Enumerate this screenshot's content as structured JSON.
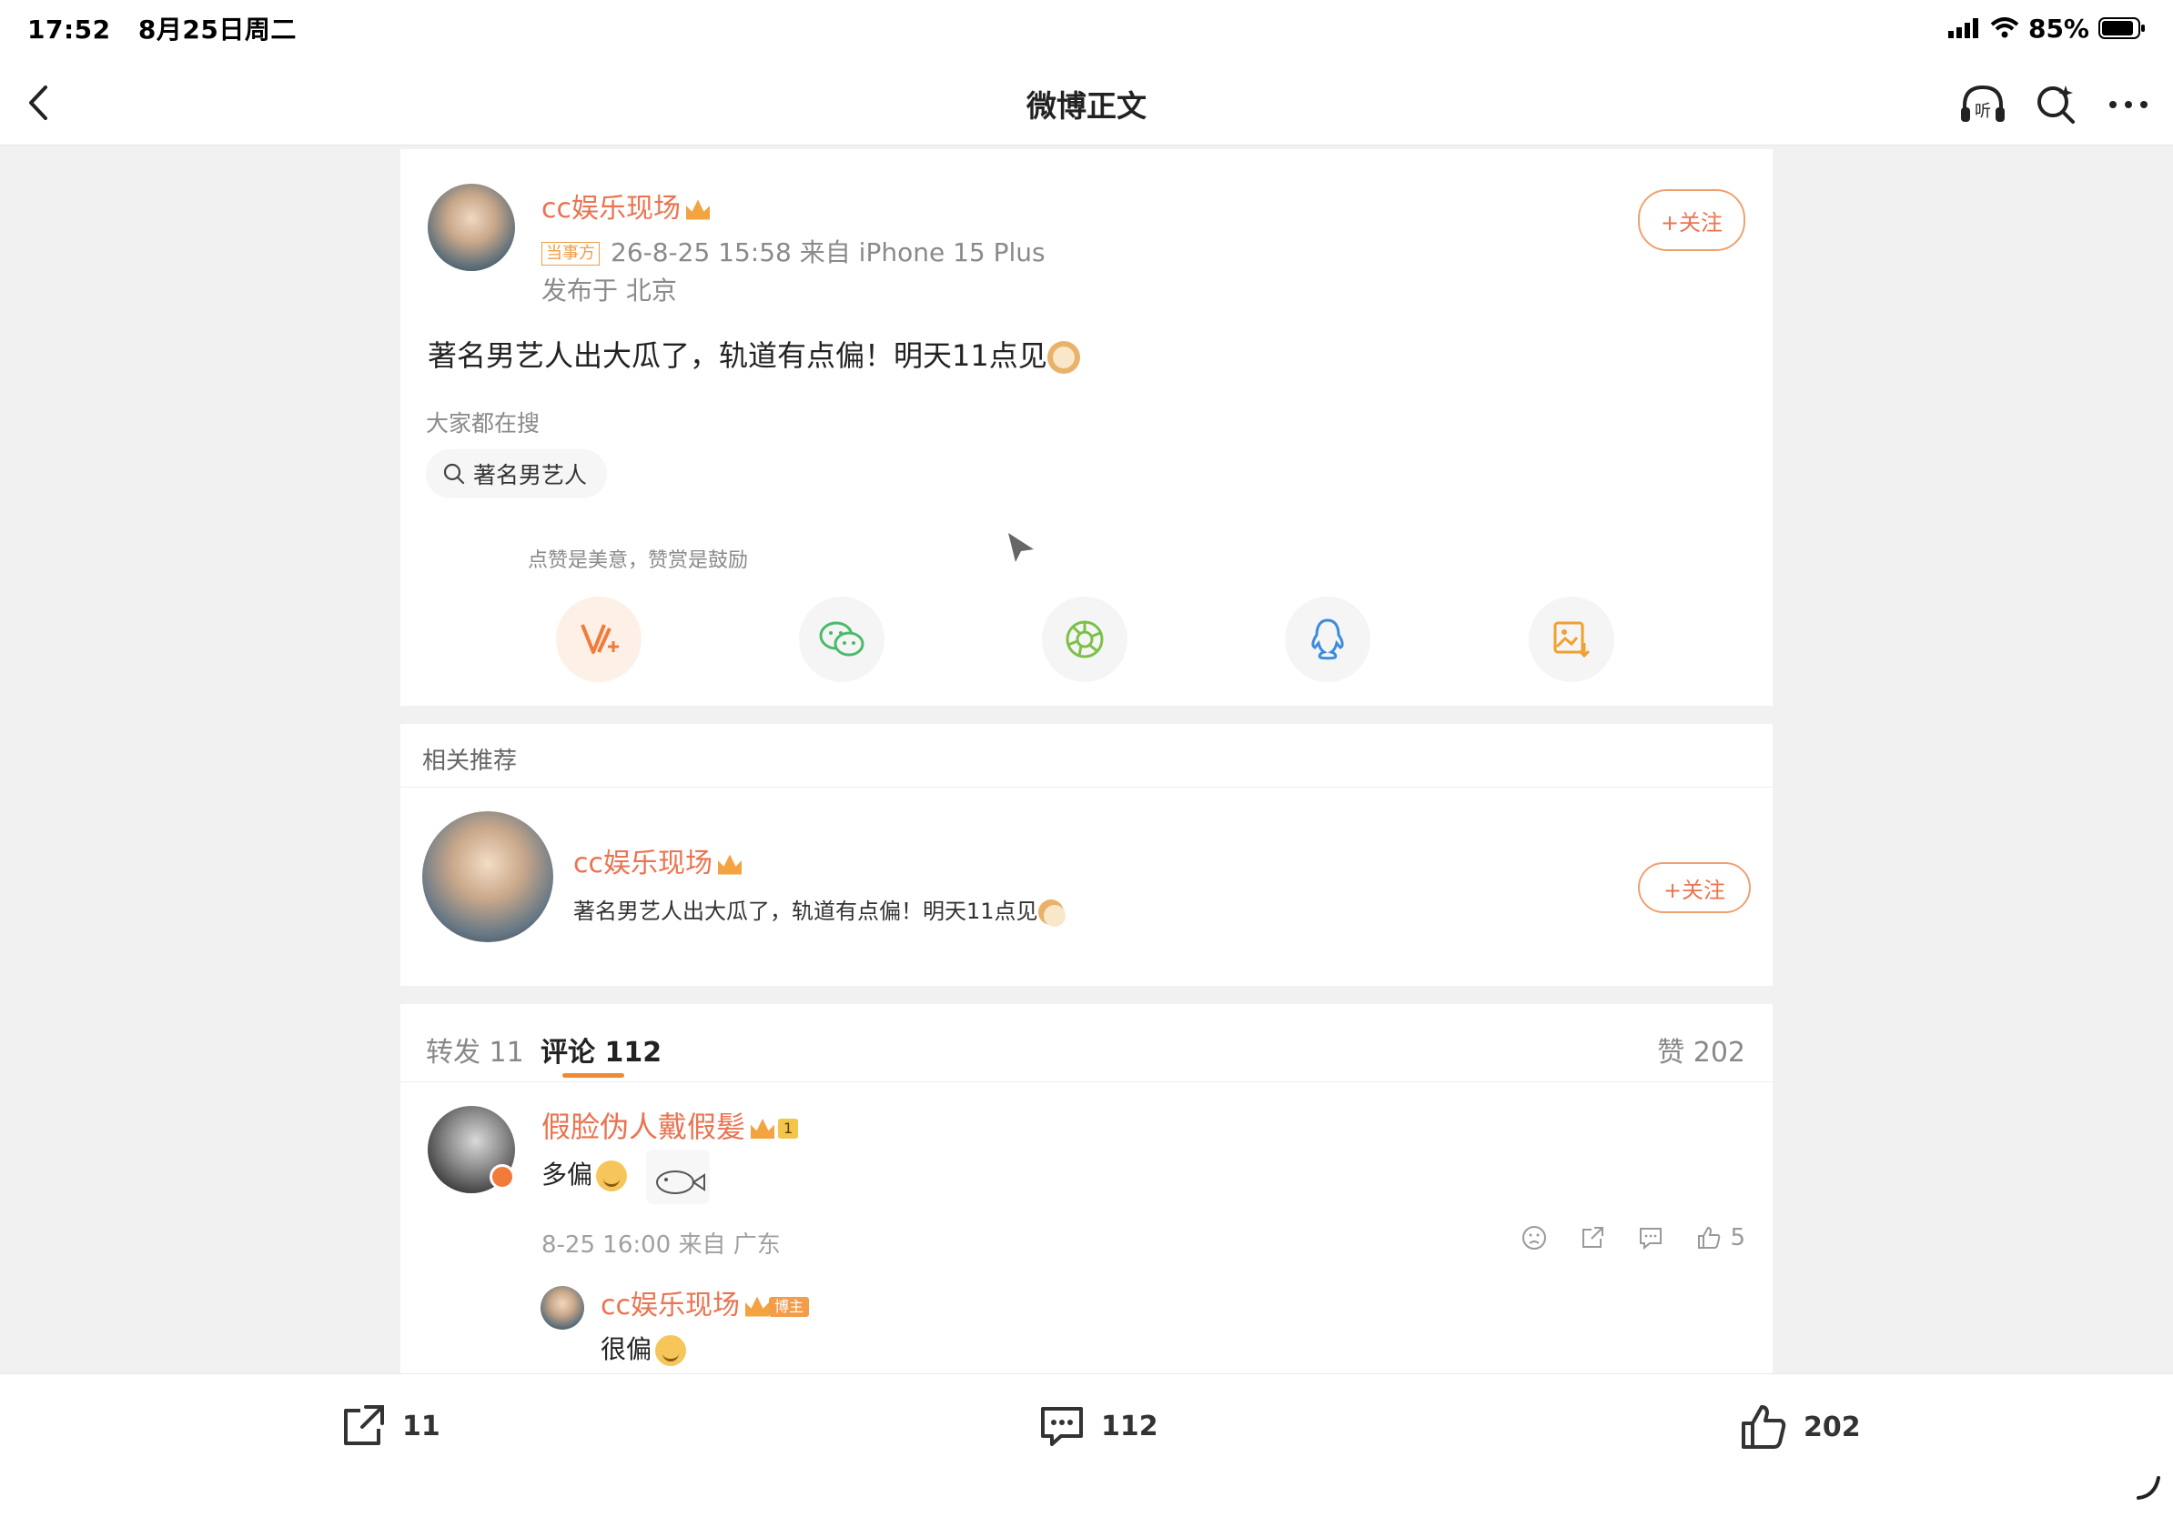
{
  "status": {
    "time": "17:52",
    "date": "8月25日周二",
    "battery": "85%"
  },
  "nav": {
    "title": "微博正文"
  },
  "post": {
    "author": "cc娱乐现场",
    "tag": "当事方",
    "time_source": "26-8-25 15:58  来自 iPhone 15 Plus",
    "location": "发布于 北京",
    "follow_label": "+关注",
    "text": "著名男艺人出大瓜了，轨道有点偏！明天11点见",
    "search_section": "大家都在搜",
    "search_chip": "著名男艺人",
    "tip": "点赞是美意，赞赏是鼓励"
  },
  "related": {
    "header": "相关推荐",
    "author": "cc娱乐现场",
    "text": "著名男艺人出大瓜了，轨道有点偏！明天11点见",
    "follow_label": "+关注"
  },
  "tabs": {
    "repost": "转发 11",
    "comment": "评论 112",
    "like": "赞 202"
  },
  "comment1": {
    "author": "假脸伪人戴假髪",
    "level": "1",
    "text": "多偏",
    "meta": "8-25 16:00 来自 广东",
    "likes": "5"
  },
  "reply1": {
    "author": "cc娱乐现场",
    "badge": "博主",
    "text": "很偏"
  },
  "bottom": {
    "repost": "11",
    "comment": "112",
    "like": "202"
  },
  "colors": {
    "accent": "#eb7350",
    "orange": "#f08a30"
  }
}
